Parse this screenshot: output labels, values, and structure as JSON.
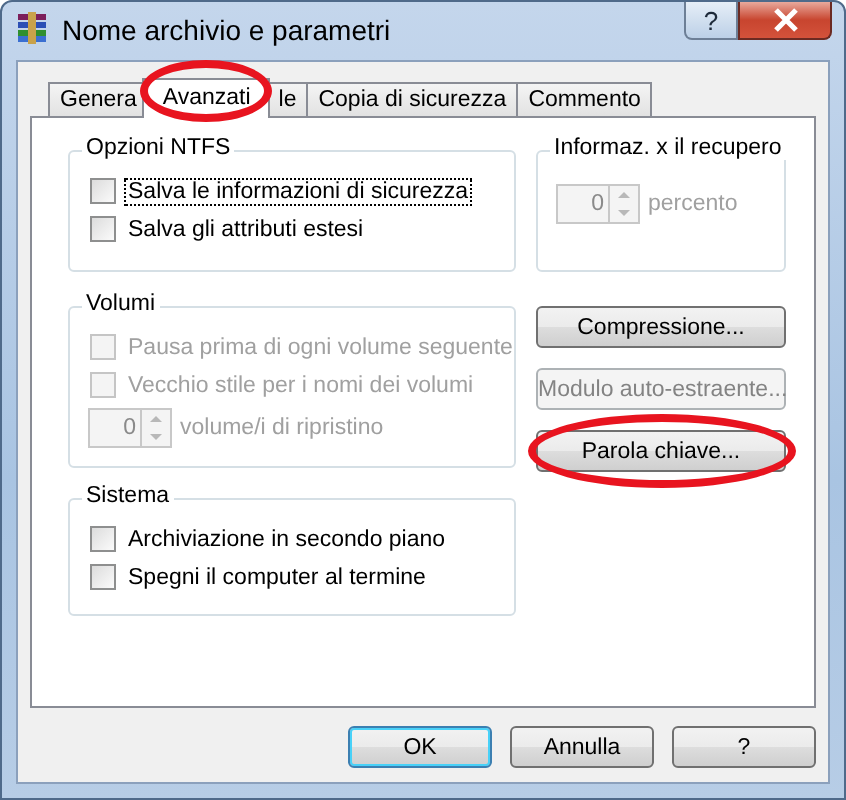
{
  "window": {
    "title": "Nome archivio e parametri",
    "help_button": "?"
  },
  "tabs": [
    {
      "label": "Genera",
      "selected": false,
      "circled": false
    },
    {
      "label": "Avanzati",
      "selected": true,
      "circled": true
    },
    {
      "label": "le",
      "selected": false,
      "circled": false
    },
    {
      "label": "Copia di sicurezza",
      "selected": false,
      "circled": false
    },
    {
      "label": "Commento",
      "selected": false,
      "circled": false
    }
  ],
  "ntfs_options": {
    "title": "Opzioni NTFS",
    "checkboxes": [
      {
        "label": "Salva le informazioni di sicurezza",
        "checked": false,
        "disabled": false,
        "focused": true
      },
      {
        "label": "Salva gli attributi estesi",
        "checked": false,
        "disabled": false,
        "focused": false
      }
    ]
  },
  "recovery_info": {
    "title": "Informaz. x il recupero",
    "spinner": {
      "value": "0",
      "disabled": true
    },
    "unit": "percento"
  },
  "volumes": {
    "title": "Volumi",
    "checkboxes": [
      {
        "label": "Pausa prima di ogni volume seguente",
        "checked": false,
        "disabled": true,
        "focused": false
      },
      {
        "label": "Vecchio stile per i nomi dei volumi",
        "checked": false,
        "disabled": true,
        "focused": false
      }
    ],
    "spinner": {
      "value": "0",
      "disabled": true
    },
    "unit": "volume/i di ripristino"
  },
  "side_buttons": [
    {
      "label": "Compressione...",
      "disabled": false,
      "circled": false
    },
    {
      "label": "Modulo auto-estraente...",
      "disabled": true,
      "circled": false
    },
    {
      "label": "Parola chiave...",
      "disabled": false,
      "circled": true
    }
  ],
  "system": {
    "title": "Sistema",
    "checkboxes": [
      {
        "label": "Archiviazione in secondo piano",
        "checked": false,
        "disabled": false,
        "focused": false
      },
      {
        "label": "Spegni il computer al termine",
        "checked": false,
        "disabled": false,
        "focused": false
      }
    ]
  },
  "buttons": [
    {
      "label": "OK",
      "default": true
    },
    {
      "label": "Annulla",
      "default": false
    },
    {
      "label": "?",
      "default": false
    }
  ]
}
